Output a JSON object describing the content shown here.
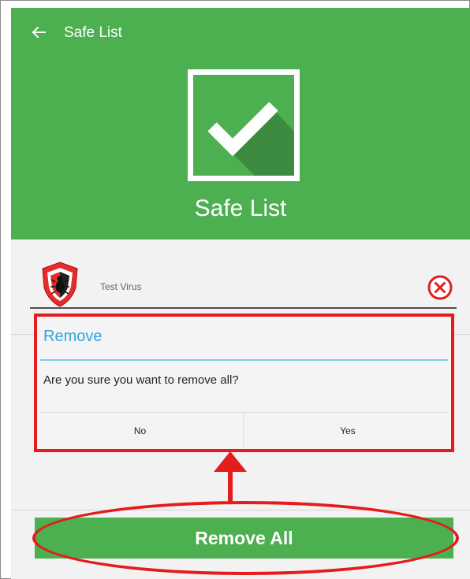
{
  "toolbar": {
    "title": "Safe List",
    "back_icon": "arrow-left-icon"
  },
  "hero": {
    "title": "Safe List",
    "icon": "checkmark-icon"
  },
  "safe_list": {
    "items": [
      {
        "name": "Test Virus",
        "icon": "virus-shield-icon",
        "remove_icon": "close-circle-icon"
      }
    ]
  },
  "dialog": {
    "title": "Remove",
    "message": "Are you sure you want to remove all?",
    "no_label": "No",
    "yes_label": "Yes"
  },
  "footer": {
    "remove_all_label": "Remove All"
  },
  "colors": {
    "header_green": "#4caf50",
    "dialog_title_blue": "#2ea6dd",
    "highlight_red": "#e41c1c"
  }
}
